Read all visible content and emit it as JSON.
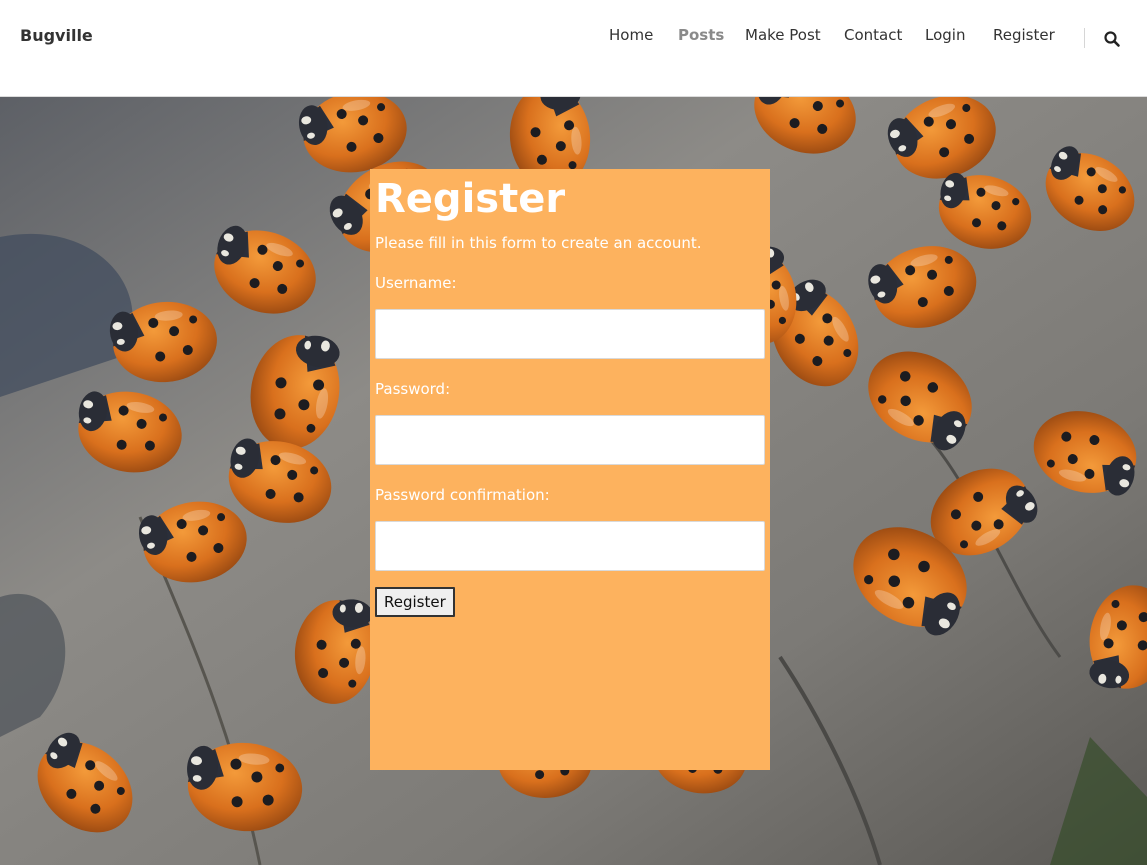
{
  "site": {
    "brand": "Bugville"
  },
  "nav": {
    "items": [
      {
        "label": "Home",
        "active": false
      },
      {
        "label": "Posts",
        "active": true
      },
      {
        "label": "Make Post",
        "active": false
      },
      {
        "label": "Contact",
        "active": false
      },
      {
        "label": "Login",
        "active": false
      },
      {
        "label": "Register",
        "active": false
      }
    ],
    "search_icon": "search-icon"
  },
  "hero": {
    "background": "ladybugs-on-tree-stump photo"
  },
  "form": {
    "title": "Register",
    "subtitle": "Please fill in this form to create an account.",
    "fields": [
      {
        "label": "Username:",
        "value": "",
        "placeholder": ""
      },
      {
        "label": "Password:",
        "value": "",
        "placeholder": ""
      },
      {
        "label": "Password confirmation:",
        "value": "",
        "placeholder": ""
      }
    ],
    "submit_label": "Register"
  },
  "colors": {
    "panel": "#fdb25e",
    "header_bg": "#ffffff",
    "nav_text": "#333333",
    "nav_active": "#8a8a8a"
  }
}
